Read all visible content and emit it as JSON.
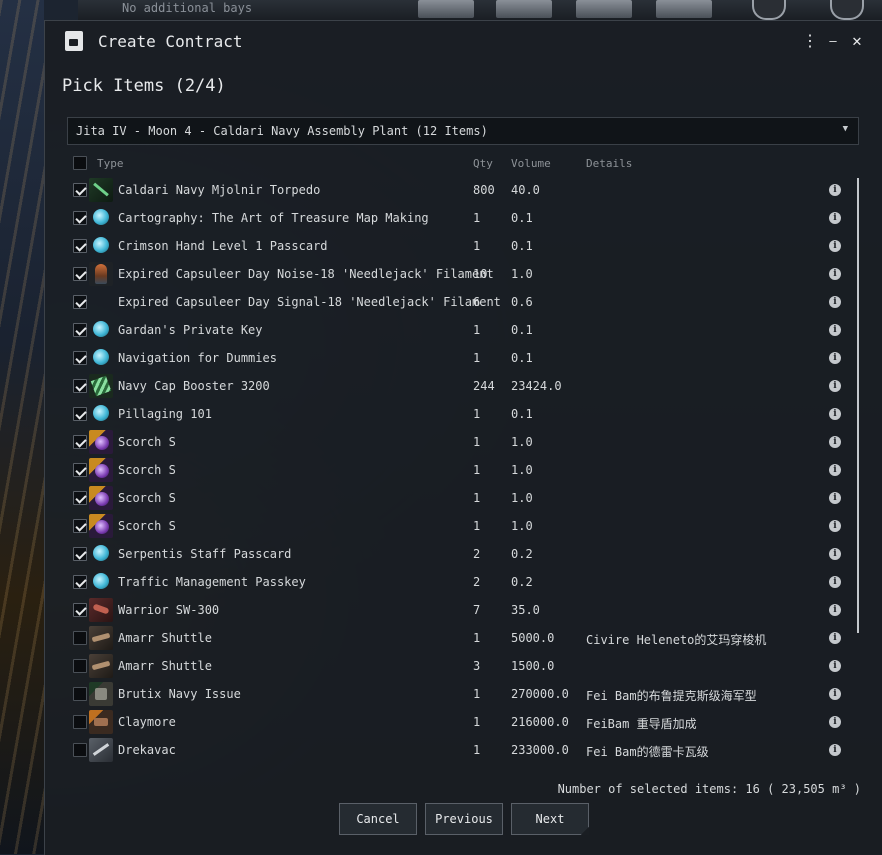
{
  "background": {
    "topbar_text": "No additional bays"
  },
  "window": {
    "title": "Create Contract",
    "controls": {
      "menu": "⋮",
      "minimize": "—",
      "close": "✕"
    }
  },
  "step": {
    "title": "Pick Items (2/4)"
  },
  "location": {
    "selected": "Jita IV - Moon 4 - Caldari Navy Assembly Plant (12 Items)"
  },
  "table": {
    "columns": {
      "type": "Type",
      "qty": "Qty",
      "volume": "Volume",
      "details": "Details"
    },
    "rows": [
      {
        "checked": true,
        "icon": "torpedo",
        "name": "Caldari Navy Mjolnir Torpedo",
        "qty": "800",
        "volume": "40.0",
        "details": ""
      },
      {
        "checked": true,
        "icon": "book",
        "name": "Cartography: The Art of Treasure Map Making",
        "qty": "1",
        "volume": "0.1",
        "details": ""
      },
      {
        "checked": true,
        "icon": "key",
        "name": "Crimson Hand Level 1 Passcard",
        "qty": "1",
        "volume": "0.1",
        "details": ""
      },
      {
        "checked": true,
        "icon": "filament",
        "name": "Expired Capsuleer Day Noise-18 'Needlejack' Filament",
        "qty": "10",
        "volume": "1.0",
        "details": ""
      },
      {
        "checked": true,
        "icon": "filament2",
        "name": "Expired Capsuleer Day Signal-18 'Needlejack' Filament",
        "qty": "6",
        "volume": "0.6",
        "details": ""
      },
      {
        "checked": true,
        "icon": "key",
        "name": "Gardan's Private Key",
        "qty": "1",
        "volume": "0.1",
        "details": ""
      },
      {
        "checked": true,
        "icon": "book",
        "name": "Navigation for Dummies",
        "qty": "1",
        "volume": "0.1",
        "details": ""
      },
      {
        "checked": true,
        "icon": "booster",
        "name": "Navy Cap Booster 3200",
        "qty": "244",
        "volume": "23424.0",
        "details": ""
      },
      {
        "checked": true,
        "icon": "book",
        "name": "Pillaging 101",
        "qty": "1",
        "volume": "0.1",
        "details": ""
      },
      {
        "checked": true,
        "icon": "scorch",
        "name": "Scorch S",
        "qty": "1",
        "volume": "1.0",
        "details": ""
      },
      {
        "checked": true,
        "icon": "scorch",
        "name": "Scorch S",
        "qty": "1",
        "volume": "1.0",
        "details": ""
      },
      {
        "checked": true,
        "icon": "scorch",
        "name": "Scorch S",
        "qty": "1",
        "volume": "1.0",
        "details": ""
      },
      {
        "checked": true,
        "icon": "scorch",
        "name": "Scorch S",
        "qty": "1",
        "volume": "1.0",
        "details": ""
      },
      {
        "checked": true,
        "icon": "key",
        "name": "Serpentis Staff Passcard",
        "qty": "2",
        "volume": "0.2",
        "details": ""
      },
      {
        "checked": true,
        "icon": "key",
        "name": "Traffic Management Passkey",
        "qty": "2",
        "volume": "0.2",
        "details": ""
      },
      {
        "checked": true,
        "icon": "drone",
        "name": "Warrior SW-300",
        "qty": "7",
        "volume": "35.0",
        "details": ""
      },
      {
        "checked": false,
        "icon": "ship",
        "name": "Amarr Shuttle",
        "qty": "1",
        "volume": "5000.0",
        "details": "Civire Heleneto的艾玛穿梭机"
      },
      {
        "checked": false,
        "icon": "ship",
        "name": "Amarr Shuttle",
        "qty": "3",
        "volume": "1500.0",
        "details": ""
      },
      {
        "checked": false,
        "icon": "navy",
        "name": "Brutix Navy Issue",
        "qty": "1",
        "volume": "270000.0",
        "details": "Fei Bam的布鲁提克斯级海军型"
      },
      {
        "checked": false,
        "icon": "clay",
        "name": "Claymore",
        "qty": "1",
        "volume": "216000.0",
        "details": "FeiBam 重导盾加成"
      },
      {
        "checked": false,
        "icon": "drek",
        "name": "Drekavac",
        "qty": "1",
        "volume": "233000.0",
        "details": "Fei Bam的德雷卡瓦级"
      }
    ]
  },
  "summary": "Number of selected items: 16 ( 23,505 m³ )",
  "buttons": {
    "cancel": "Cancel",
    "previous": "Previous",
    "next": "Next"
  }
}
